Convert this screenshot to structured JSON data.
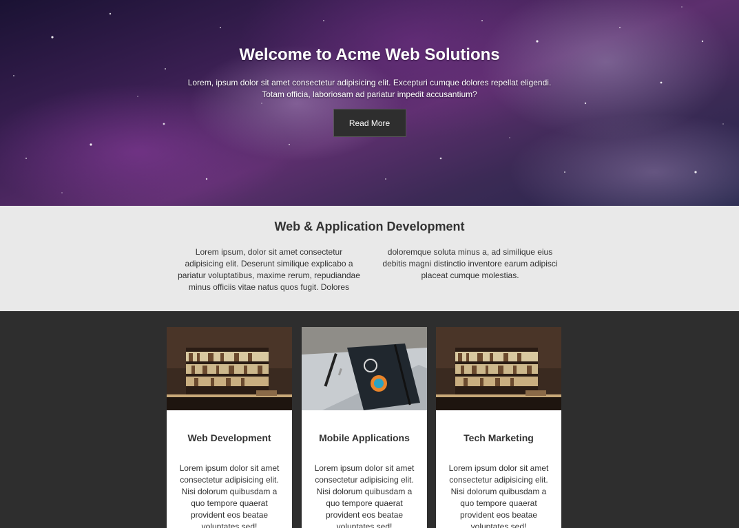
{
  "hero": {
    "title": "Welcome to Acme Web Solutions",
    "text": "Lorem, ipsum dolor sit amet consectetur adipisicing elit. Excepturi cumque dolores repellat eligendi. Totam officia, laboriosam ad pariatur impedit accusantium?",
    "button_label": "Read More"
  },
  "development": {
    "title": "Web & Application Development",
    "col1": "Lorem ipsum, dolor sit amet consectetur adipisicing elit. Deserunt similique explicabo a pariatur voluptatibus, maxime rerum, repudiandae minus officiis vitae natus quos fugit. Dolores",
    "col2": "doloremque soluta minus a, ad similique eius debitis magni distinctio inventore earum adipisci placeat cumque molestias."
  },
  "cards": [
    {
      "title": "Web Development",
      "text": "Lorem ipsum dolor sit amet consectetur adipisicing elit. Nisi dolorum quibusdam a quo tempore quaerat provident eos beatae voluptates sed!",
      "image": "bookshelf-image"
    },
    {
      "title": "Mobile Applications",
      "text": "Lorem ipsum dolor sit amet consectetur adipisicing elit. Nisi dolorum quibusdam a quo tempore quaerat provident eos beatae voluptates sed!",
      "image": "notebook-pen-image"
    },
    {
      "title": "Tech Marketing",
      "text": "Lorem ipsum dolor sit amet consectetur adipisicing elit. Nisi dolorum quibusdam a quo tempore quaerat provident eos beatae voluptates sed!",
      "image": "bookshelf-image"
    }
  ],
  "colors": {
    "dark": "#2e2e2e",
    "light_section": "#e9e9e9",
    "text": "#333333"
  }
}
